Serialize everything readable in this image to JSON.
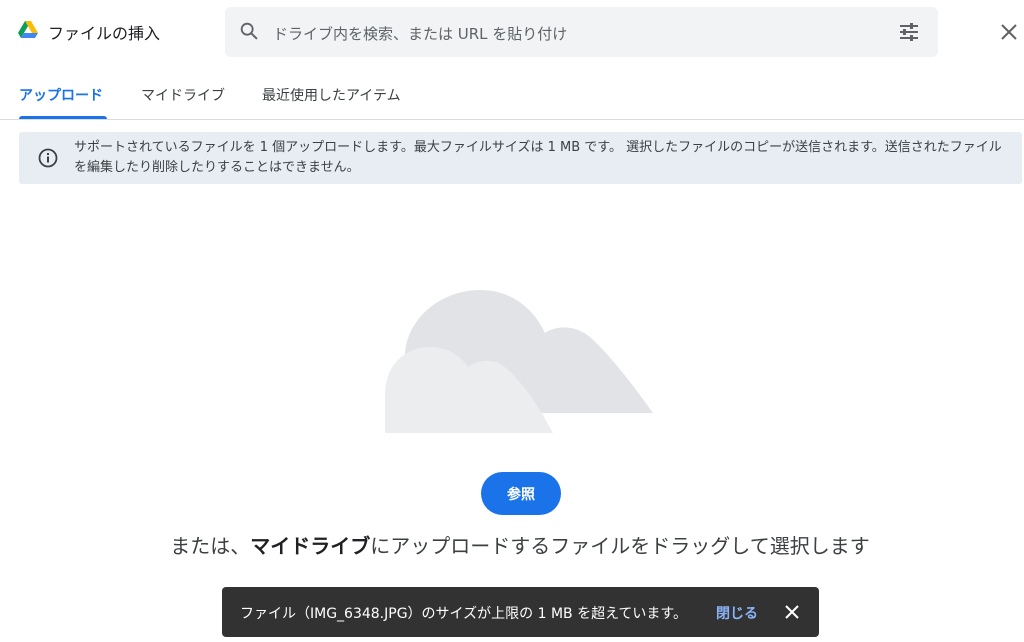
{
  "header": {
    "title": "ファイルの挿入",
    "search_placeholder": "ドライブ内を検索、または URL を貼り付け"
  },
  "tabs": [
    {
      "label": "アップロード",
      "active": true
    },
    {
      "label": "マイドライブ",
      "active": false
    },
    {
      "label": "最近使用したアイテム",
      "active": false
    }
  ],
  "banner": {
    "text": "サポートされているファイルを 1 個アップロードします。最大ファイルサイズは 1 MB です。 選択したファイルのコピーが送信されます。送信されたファイルを編集したり削除したりすることはできません。"
  },
  "upload": {
    "browse_label": "参照",
    "drag_prefix": "または、",
    "drag_bold": "マイドライブ",
    "drag_suffix": "にアップロードするファイルをドラッグして選択します"
  },
  "toast": {
    "message": "ファイル（IMG_6348.JPG）のサイズが上限の 1 MB を超えています。",
    "close_label": "閉じる"
  },
  "colors": {
    "accent": "#1a73e8",
    "toast_bg": "#323232",
    "banner_bg": "#e8edf3"
  },
  "icons": [
    "drive-logo-icon",
    "search-icon",
    "tune-icon",
    "close-icon",
    "info-icon",
    "cloud-icon",
    "toast-close-icon"
  ]
}
